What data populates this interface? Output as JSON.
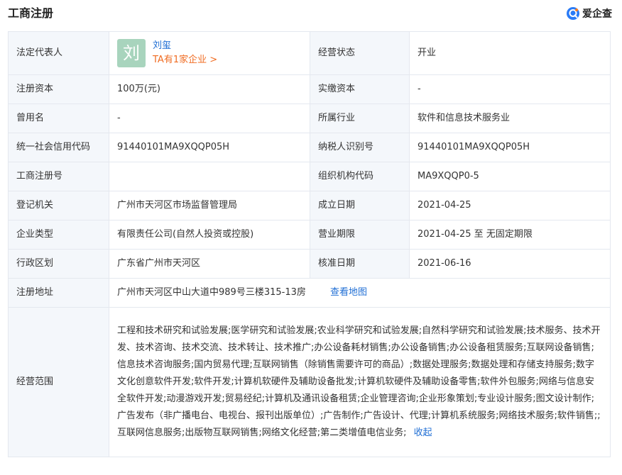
{
  "header": {
    "title": "工商注册",
    "brand": "爱企查",
    "brand_icon": "search-q-icon"
  },
  "colors": {
    "label_bg": "#f4f7fb",
    "border": "#e4e8ef",
    "link": "#1f6ed4",
    "orange_link": "#f06c22",
    "avatar_bg": "#a8d4bd"
  },
  "rows": {
    "legal_rep": {
      "label": "法定代表人",
      "avatar_char": "刘",
      "name": "刘玺",
      "companies_link": "TA有1家企业 >",
      "label2": "经营状态",
      "value2": "开业"
    },
    "capital": {
      "label": "注册资本",
      "value": "100万(元)",
      "label2": "实缴资本",
      "value2": "-"
    },
    "former_name": {
      "label": "曾用名",
      "value": "-",
      "label2": "所属行业",
      "value2": "软件和信息技术服务业"
    },
    "credit_code": {
      "label": "统一社会信用代码",
      "value": "91440101MA9XQQP05H",
      "label2": "纳税人识别号",
      "value2": "91440101MA9XQQP05H"
    },
    "reg_no": {
      "label": "工商注册号",
      "value": "",
      "label2": "组织机构代码",
      "value2": "MA9XQQP0-5"
    },
    "authority": {
      "label": "登记机关",
      "value": "广州市天河区市场监督管理局",
      "label2": "成立日期",
      "value2": "2021-04-25"
    },
    "type": {
      "label": "企业类型",
      "value": "有限责任公司(自然人投资或控股)",
      "label2": "营业期限",
      "value2": "2021-04-25 至 无固定期限"
    },
    "district": {
      "label": "行政区划",
      "value": "广东省广州市天河区",
      "label2": "核准日期",
      "value2": "2021-06-16"
    },
    "address": {
      "label": "注册地址",
      "value": "广州市天河区中山大道中989号三楼315-13房",
      "map_link": "查看地图"
    },
    "scope": {
      "label": "经营范围",
      "value": "工程和技术研究和试验发展;医学研究和试验发展;农业科学研究和试验发展;自然科学研究和试验发展;技术服务、技术开发、技术咨询、技术交流、技术转让、技术推广;办公设备耗材销售;办公设备销售;办公设备租赁服务;互联网设备销售;信息技术咨询服务;国内贸易代理;互联网销售（除销售需要许可的商品）;数据处理服务;数据处理和存储支持服务;数字文化创意软件开发;软件开发;计算机软硬件及辅助设备批发;计算机软硬件及辅助设备零售;软件外包服务;网络与信息安全软件开发;动漫游戏开发;贸易经纪;计算机及通讯设备租赁;企业管理咨询;企业形象策划;专业设计服务;图文设计制作;广告发布（非广播电台、电视台、报刊出版单位）;广告制作;广告设计、代理;计算机系统服务;网络技术服务;软件销售;;互联网信息服务;出版物互联网销售;网络文化经营;第二类增值电信业务;",
      "collapse_link": "收起"
    }
  }
}
